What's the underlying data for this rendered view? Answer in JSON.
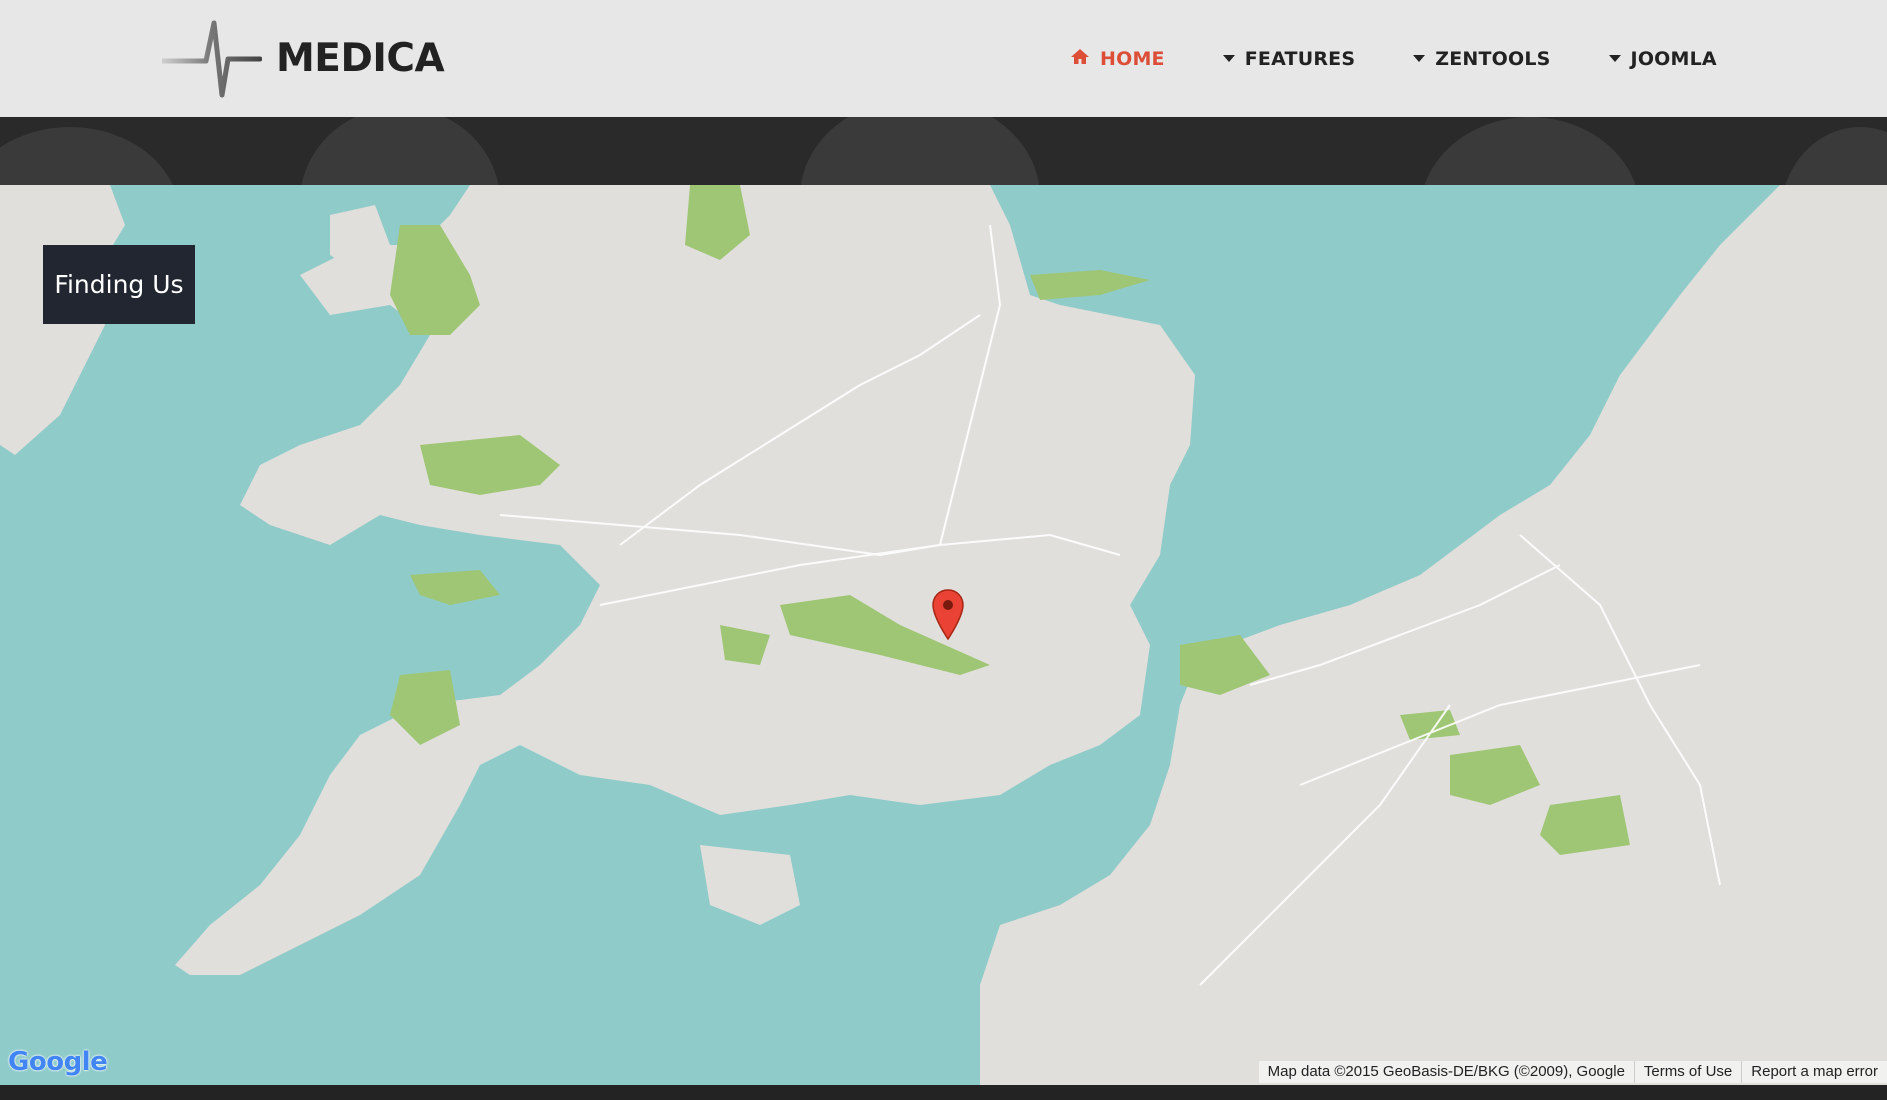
{
  "header": {
    "logo_text": "MEDICA",
    "logo_icon": "heartbeat-line-icon"
  },
  "nav": {
    "items": [
      {
        "label": "HOME",
        "icon": "home-icon",
        "active": true
      },
      {
        "label": "FEATURES",
        "icon": "caret-down-icon",
        "active": false
      },
      {
        "label": "ZENTOOLS",
        "icon": "caret-down-icon",
        "active": false
      },
      {
        "label": "JOOMLA",
        "icon": "caret-down-icon",
        "active": false
      }
    ]
  },
  "map": {
    "label": "Finding Us",
    "marker": "map-pin-icon",
    "google_logo": "Google",
    "attribution": "Map data ©2015 GeoBasis-DE/BKG (©2009), Google",
    "terms": "Terms of Use",
    "report": "Report a map error"
  },
  "colors": {
    "accent": "#dc4e38",
    "header_bg": "#e7e7e7",
    "water": "#8fcbc9",
    "land": "#e1dfdc",
    "parks": "#9fc674",
    "label_bg": "#212631"
  }
}
